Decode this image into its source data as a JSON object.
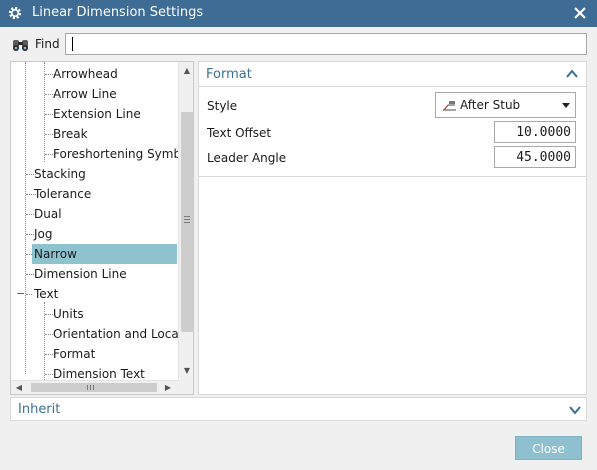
{
  "window": {
    "title": "Linear Dimension Settings",
    "settings_icon": "gear-icon",
    "close_icon": "close-x-icon"
  },
  "find": {
    "label": "Find",
    "value": "",
    "icon": "binoculars-icon"
  },
  "tree": {
    "items": [
      {
        "label": "Arrowhead",
        "level": 2
      },
      {
        "label": "Arrow Line",
        "level": 2
      },
      {
        "label": "Extension Line",
        "level": 2
      },
      {
        "label": "Break",
        "level": 2
      },
      {
        "label": "Foreshortening Symbol",
        "level": 2
      },
      {
        "label": "Stacking",
        "level": 1
      },
      {
        "label": "Tolerance",
        "level": 1
      },
      {
        "label": "Dual",
        "level": 1
      },
      {
        "label": "Jog",
        "level": 1
      },
      {
        "label": "Narrow",
        "level": 1,
        "selected": true
      },
      {
        "label": "Dimension Line",
        "level": 1
      },
      {
        "label": "Text",
        "level": 1,
        "expanded": true
      },
      {
        "label": "Units",
        "level": 2
      },
      {
        "label": "Orientation and Location",
        "level": 2
      },
      {
        "label": "Format",
        "level": 2
      },
      {
        "label": "Dimension Text",
        "level": 2
      }
    ],
    "collapse_glyph": "−"
  },
  "format_section": {
    "title": "Format",
    "style_label": "Style",
    "style_value": "After Stub",
    "text_offset_label": "Text Offset",
    "text_offset_value": "10.0000",
    "leader_angle_label": "Leader Angle",
    "leader_angle_value": "45.0000"
  },
  "inherit_section": {
    "title": "Inherit"
  },
  "buttons": {
    "close_label": "Close"
  },
  "colors": {
    "titlebar": "#3e6c94",
    "selection": "#8fc2cf",
    "section_title": "#3c6f8f",
    "close_button": "#8fc0cf"
  }
}
